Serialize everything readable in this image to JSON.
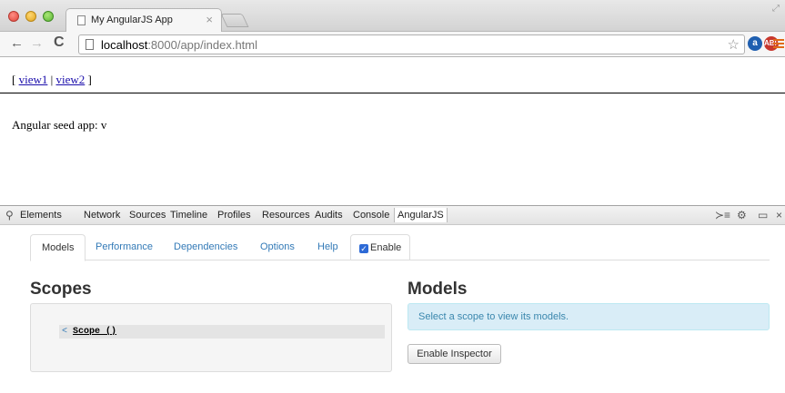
{
  "browser": {
    "tab_title": "My AngularJS App",
    "tab_close": "×",
    "url_host": "localhost",
    "url_path": ":8000/app/index.html",
    "ext1_label": "a",
    "ext2_label": "ABP"
  },
  "page": {
    "nav_open": "[",
    "nav_sep": "|",
    "nav_close": "]",
    "view1": "view1",
    "view2": "view2",
    "app_text": "Angular seed app: v"
  },
  "devtools": {
    "tabs": [
      "Elements",
      "Network",
      "Sources",
      "Timeline",
      "Profiles",
      "Resources",
      "Audits",
      "Console",
      "AngularJS"
    ],
    "active_tab": "AngularJS",
    "subtabs": [
      "Models",
      "Performance",
      "Dependencies",
      "Options",
      "Help",
      "Enable"
    ],
    "scopes_heading": "Scopes",
    "models_heading": "Models",
    "scope_caret": "<",
    "scope_label": "Scope ()",
    "models_hint": "Select a scope to view its models.",
    "inspector_button": "Enable Inspector"
  },
  "colors": {
    "link": "#337ab7",
    "alert_bg": "#d9edf7",
    "alert_text": "#3a87ad"
  }
}
